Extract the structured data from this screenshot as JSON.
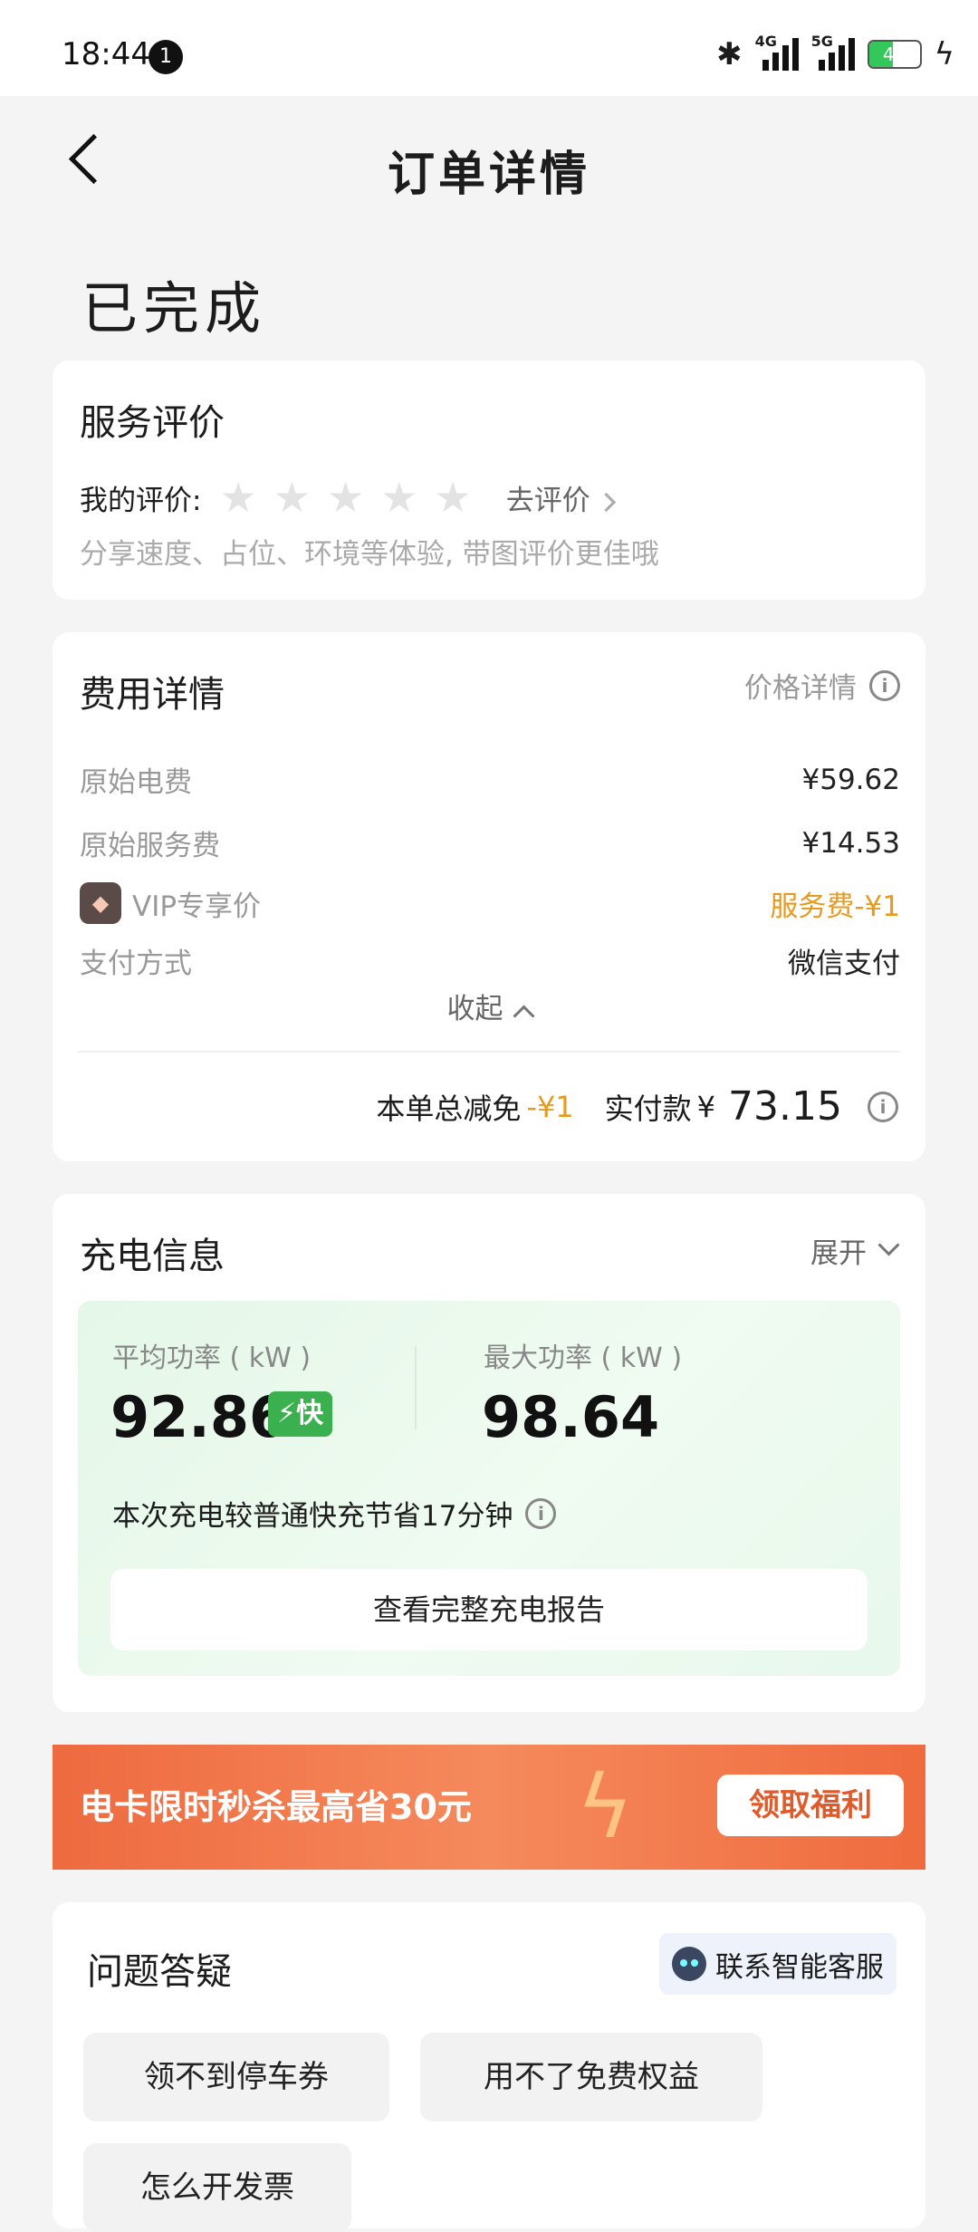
{
  "status_bar": {
    "time": "18:44",
    "notif_badge": "1",
    "net1": "4G",
    "net2": "5G",
    "battery": "47",
    "battery_level": 0.47
  },
  "header": {
    "title": "订单详情"
  },
  "order_status": "已完成",
  "rating": {
    "title": "服务评价",
    "my_rating_label": "我的评价:",
    "stars": 5,
    "go_rate": "去评价",
    "hint": "分享速度、占位、环境等体验, 带图评价更佳哦"
  },
  "fees": {
    "title": "费用详情",
    "price_detail": "价格详情",
    "rows": [
      {
        "label": "原始电费",
        "value": "¥59.62"
      },
      {
        "label": "原始服务费",
        "value": "¥14.53"
      },
      {
        "label": "VIP专享价",
        "value": "服务费-¥1"
      },
      {
        "label": "支付方式",
        "value": "微信支付"
      }
    ],
    "collapse": "收起",
    "total_discount_label": "本单总减免",
    "total_discount": "-¥1",
    "paid_label": "实付款",
    "paid_currency": "¥",
    "paid_amount": "73.15"
  },
  "charge": {
    "title": "充电信息",
    "expand": "展开",
    "avg_power_label": "平均功率 ( kW )",
    "avg_power": "92.86",
    "fast_badge": "⚡快",
    "max_power_label": "最大功率 ( kW )",
    "max_power": "98.64",
    "save_note": "本次充电较普通快充节省17分钟",
    "report_button": "查看完整充电报告"
  },
  "promo": {
    "text": "电卡限时秒杀最高省30元",
    "button": "领取福利"
  },
  "faq": {
    "title": "问题答疑",
    "cs_button": "联系智能客服",
    "chips": [
      "领不到停车券",
      "用不了免费权益",
      "怎么开发票"
    ]
  },
  "colors": {
    "accent_orange": "#e79a1e",
    "fast_green": "#3ab04e",
    "promo_red": "#ee6a3f"
  }
}
